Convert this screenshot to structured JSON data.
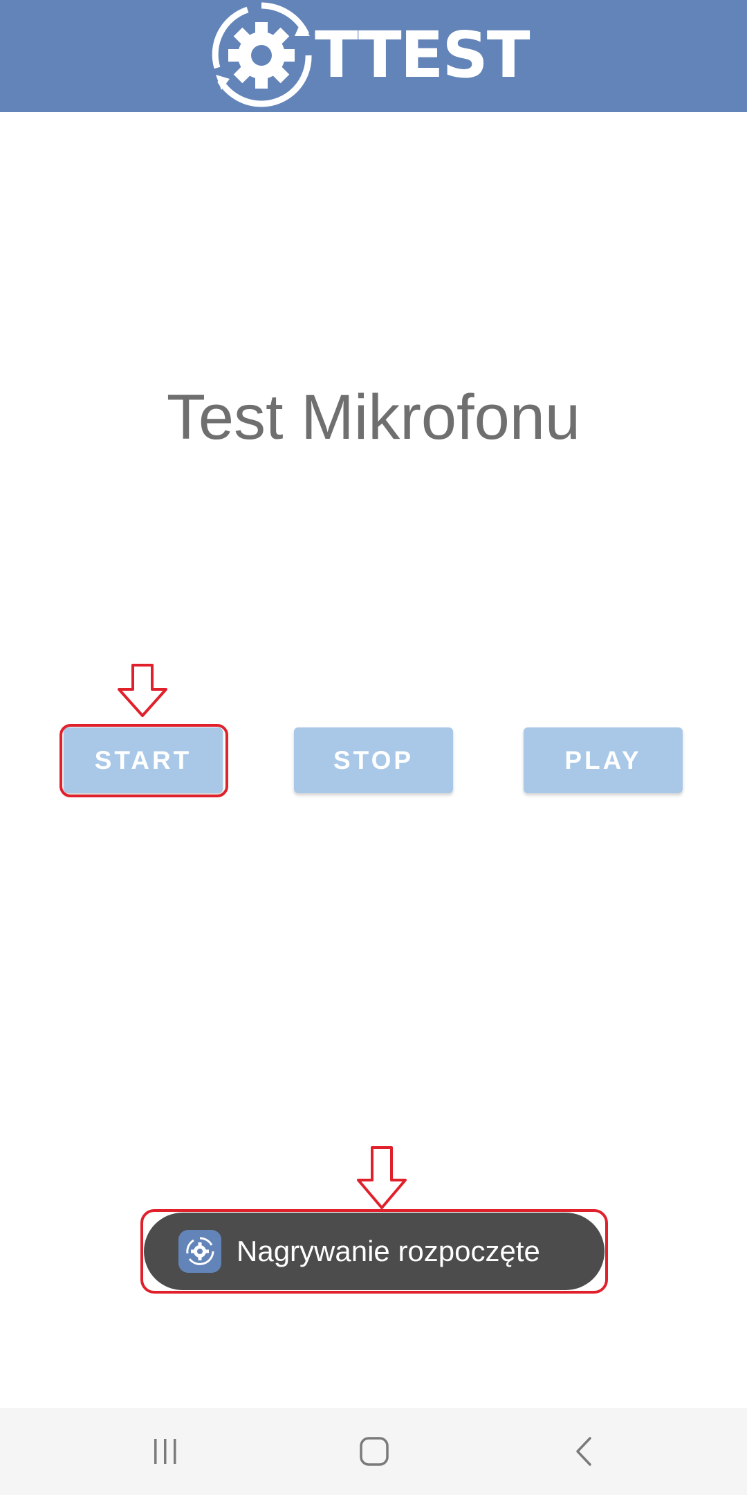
{
  "header": {
    "logo_text": "TTEST",
    "logo_icon": "gear-sync-icon",
    "background_color": "#6384b8"
  },
  "main": {
    "title": "Test Mikrofonu",
    "buttons": {
      "start_label": "START",
      "stop_label": "STOP",
      "play_label": "PLAY"
    },
    "button_color": "#a9c8e8"
  },
  "toast": {
    "icon": "app-gear-icon",
    "message": "Nagrywanie rozpoczęte"
  },
  "annotations": {
    "color": "#e0202a",
    "highlighted": [
      "start-button",
      "toast-notification"
    ]
  },
  "nav_bar": {
    "recents_icon": "recents-icon",
    "home_icon": "home-icon",
    "back_icon": "back-icon"
  }
}
